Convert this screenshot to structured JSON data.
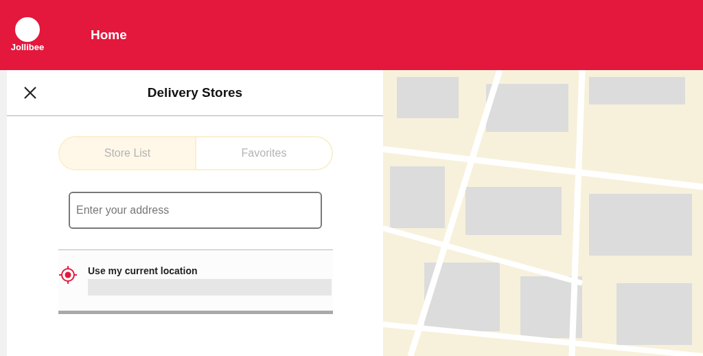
{
  "header": {
    "logo_text": "Jollibee",
    "title": "Home"
  },
  "panel": {
    "title": "Delivery Stores",
    "tabs": [
      {
        "label": "Store List",
        "selected": true
      },
      {
        "label": "Favorites",
        "selected": false
      }
    ],
    "address_field": {
      "placeholder": "Enter your address"
    },
    "current_location": {
      "label": "Use my current location"
    }
  }
}
